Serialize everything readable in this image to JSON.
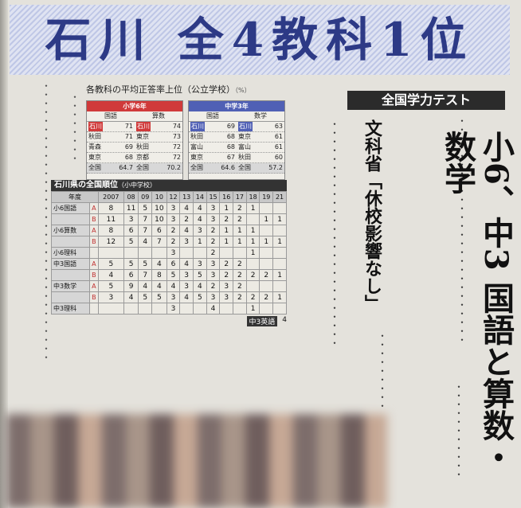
{
  "headline": "石川 全4教科1位",
  "badge": "全国学力テスト",
  "subhead": "小6、中3 国語と算数・数学",
  "ministry_label": "文科省「休校影響なし」",
  "avg_table": {
    "title": "各教科の平均正答率上位（公立学校）",
    "title_unit": "（%）",
    "elementary": {
      "header": "小学6年",
      "subjects": [
        "国語",
        "算数"
      ],
      "rows": [
        [
          [
            "石川",
            "71"
          ],
          [
            "石川",
            "74"
          ]
        ],
        [
          [
            "秋田",
            "71"
          ],
          [
            "東京",
            "73"
          ]
        ],
        [
          [
            "青森",
            "69"
          ],
          [
            "秋田",
            "72"
          ]
        ],
        [
          [
            "東京",
            "68"
          ],
          [
            "京都",
            "72"
          ]
        ]
      ],
      "national": [
        "全国",
        "64.7",
        "全国",
        "70.2"
      ]
    },
    "junior": {
      "header": "中学3年",
      "subjects": [
        "国語",
        "数学"
      ],
      "rows": [
        [
          [
            "石川",
            "69"
          ],
          [
            "石川",
            "63"
          ]
        ],
        [
          [
            "秋田",
            "68"
          ],
          [
            "東京",
            "61"
          ]
        ],
        [
          [
            "富山",
            "68"
          ],
          [
            "富山",
            "61"
          ]
        ],
        [
          [
            "東京",
            "67"
          ],
          [
            "秋田",
            "60"
          ]
        ]
      ],
      "national": [
        "全国",
        "64.6",
        "全国",
        "57.2"
      ]
    }
  },
  "ranking": {
    "title": "石川県の全国順位",
    "title_note": "（小中学校）",
    "years": [
      "年度",
      "2007",
      "08",
      "09",
      "10",
      "12",
      "13",
      "14",
      "15",
      "16",
      "17",
      "18",
      "19",
      "21"
    ],
    "rows": [
      {
        "label": "小6国語",
        "sub": "A",
        "values": [
          "8",
          "11",
          "5",
          "10",
          "3",
          "4",
          "4",
          "3",
          "1",
          "2",
          "1",
          "",
          ""
        ]
      },
      {
        "label": "",
        "sub": "B",
        "values": [
          "11",
          "3",
          "7",
          "10",
          "3",
          "2",
          "4",
          "3",
          "2",
          "2",
          "",
          "1",
          "1"
        ]
      },
      {
        "label": "小6算数",
        "sub": "A",
        "values": [
          "8",
          "6",
          "7",
          "6",
          "2",
          "4",
          "3",
          "2",
          "1",
          "1",
          "1",
          "",
          ""
        ]
      },
      {
        "label": "",
        "sub": "B",
        "values": [
          "12",
          "5",
          "4",
          "7",
          "2",
          "3",
          "1",
          "2",
          "1",
          "1",
          "1",
          "1",
          "1"
        ]
      },
      {
        "label": "小6理科",
        "sub": "",
        "values": [
          "",
          "",
          "",
          "",
          "3",
          "",
          "",
          "2",
          "",
          "",
          "1",
          "",
          ""
        ]
      },
      {
        "label": "中3国語",
        "sub": "A",
        "values": [
          "5",
          "5",
          "5",
          "4",
          "6",
          "4",
          "3",
          "3",
          "2",
          "2",
          "",
          "",
          ""
        ]
      },
      {
        "label": "",
        "sub": "B",
        "values": [
          "4",
          "6",
          "7",
          "8",
          "5",
          "3",
          "5",
          "3",
          "2",
          "2",
          "2",
          "2",
          "1"
        ]
      },
      {
        "label": "中3数学",
        "sub": "A",
        "values": [
          "5",
          "9",
          "4",
          "4",
          "4",
          "3",
          "4",
          "2",
          "3",
          "2",
          "",
          "",
          ""
        ]
      },
      {
        "label": "",
        "sub": "B",
        "values": [
          "3",
          "4",
          "5",
          "5",
          "3",
          "4",
          "5",
          "3",
          "3",
          "2",
          "2",
          "2",
          "1"
        ]
      },
      {
        "label": "中3理科",
        "sub": "",
        "values": [
          "",
          "",
          "",
          "",
          "3",
          "",
          "",
          "4",
          "",
          "",
          "1",
          "",
          ""
        ]
      }
    ],
    "english": [
      "中3英語",
      "4"
    ]
  }
}
